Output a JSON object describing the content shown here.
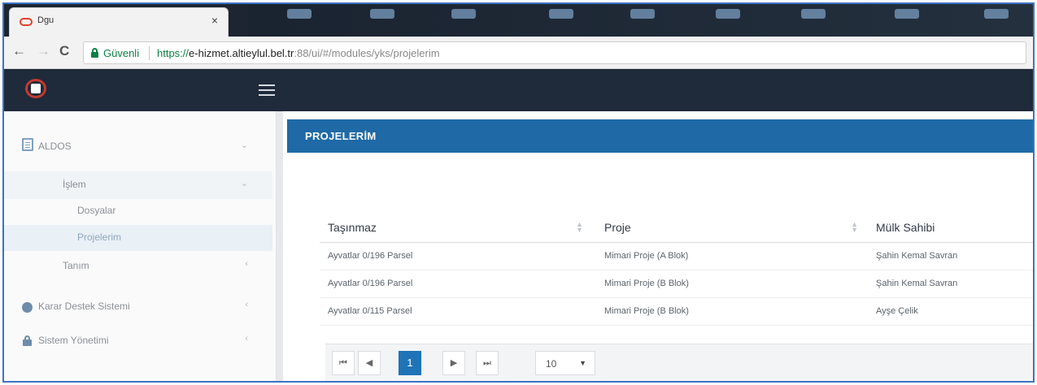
{
  "browser": {
    "tab_title": "Dgu",
    "tab_close": "×",
    "secure_label": "Güvenli",
    "url_scheme": "https://",
    "url_host": "e-hizmet.altieylul.bel.tr",
    "url_rest": ":88/ui/#/modules/yks/projelerim"
  },
  "sidebar": {
    "items": [
      {
        "label": "ALDOS",
        "icon": "document-icon"
      },
      {
        "label": "İşlem"
      },
      {
        "label": "Dosyalar"
      },
      {
        "label": "Projelerim"
      },
      {
        "label": "Tanım"
      },
      {
        "label": "Karar Destek Sistemi",
        "icon": "globe-icon"
      },
      {
        "label": "Sistem Yönetimi",
        "icon": "lock-icon"
      }
    ]
  },
  "main": {
    "title": "PROJELERİM",
    "table": {
      "headers": [
        "Taşınmaz",
        "Proje",
        "Mülk Sahibi"
      ],
      "rows": [
        [
          "Ayvatlar 0/196 Parsel",
          "Mimari Proje (A Blok)",
          "Şahin Kemal Savran"
        ],
        [
          "Ayvatlar 0/196 Parsel",
          "Mimari Proje (B Blok)",
          "Şahin Kemal Savran"
        ],
        [
          "Ayvatlar 0/115 Parsel",
          "Mimari Proje (B Blok)",
          "Ayşe Çelik"
        ]
      ]
    },
    "pager": {
      "first": "⏮",
      "prev": "◀",
      "current_page": "1",
      "next": "▶",
      "last": "⏭",
      "page_size": "10"
    }
  },
  "colors": {
    "header_bg": "#1f2a3a",
    "panel_blue": "#1f6aa6",
    "secure_green": "#0b8043",
    "page_active": "#1f73b7"
  }
}
